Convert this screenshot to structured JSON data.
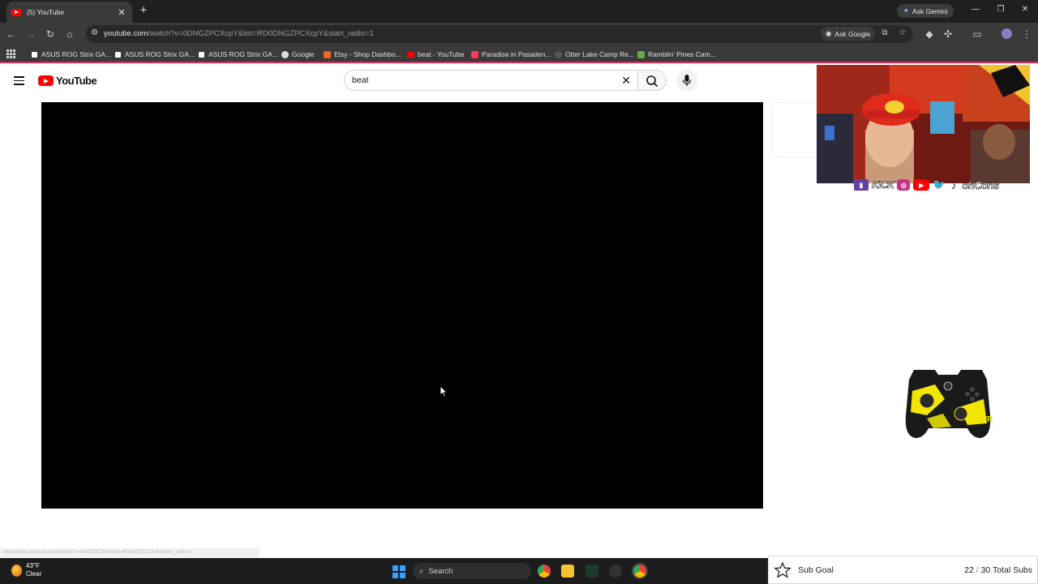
{
  "browser": {
    "tab_title": "(5) YouTube",
    "gemini_label": "Ask Gemini",
    "url_host": "youtube.com",
    "url_path": "/watch?v=0DNGZPCXcpY&list=RD0DNGZPCXcpY&start_radio=1",
    "ask_google_label": "Ask Google",
    "status_url": "https://www.youtube.com/watch?v=nhXf2C1C87lo&list=RDmKQC1C87lo&start_radio=1"
  },
  "bookmarks": [
    {
      "label": "ASUS ROG Strix GA...",
      "icon": "notion-icon",
      "color": "#ffffff"
    },
    {
      "label": "ASUS ROG Strix GA...",
      "icon": "notion-icon",
      "color": "#ffffff"
    },
    {
      "label": "ASUS ROG Strix GA...",
      "icon": "notion-icon",
      "color": "#ffffff"
    },
    {
      "label": "Google",
      "icon": "google-icon",
      "color": "#dddddd"
    },
    {
      "label": "Etsy - Shop Dashbo...",
      "icon": "etsy-icon",
      "color": "#f1641e"
    },
    {
      "label": "beat - YouTube",
      "icon": "youtube-icon",
      "color": "#ff0000"
    },
    {
      "label": "Paradise in Pasaden...",
      "icon": "airbnb-icon",
      "color": "#ff385c"
    },
    {
      "label": "Otter Lake Camp Re...",
      "icon": "site-icon",
      "color": "#555555"
    },
    {
      "label": "Ramblin' Pines Cam...",
      "icon": "site-icon",
      "color": "#6aa84f"
    }
  ],
  "youtube": {
    "logo_text": "YouTube",
    "search_query": "beat"
  },
  "overlay": {
    "kick_label": "KICK",
    "handle": "ohCons",
    "controller_text": "PWR"
  },
  "taskbar": {
    "temperature": "43°F",
    "condition": "Clear",
    "search_label": "Search"
  },
  "subgoal": {
    "label": "Sub Goal",
    "current": "22",
    "separator": " / ",
    "target": "30 Total Subs"
  }
}
